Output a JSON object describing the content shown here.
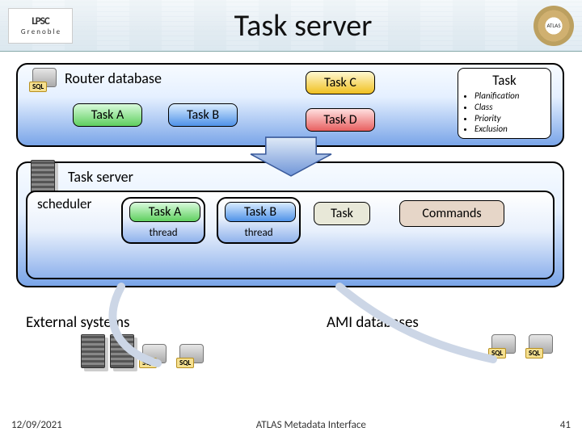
{
  "title": "Task server",
  "logos": {
    "lpsc_top": "LPSC",
    "lpsc_sub": "G r e n o b l e",
    "atlas": "ATLAS"
  },
  "router": {
    "label": "Router database",
    "tasks": {
      "a": "Task A",
      "b": "Task B",
      "c": "Task C",
      "d": "Task D"
    }
  },
  "task_info": {
    "header": "Task",
    "items": [
      "Planification",
      "Class",
      "Priority",
      "Exclusion"
    ]
  },
  "server": {
    "label": "Task server",
    "scheduler_label": "scheduler",
    "task_a": "Task A",
    "task_b": "Task B",
    "task_generic": "Task",
    "thread": "thread",
    "commands": "Commands"
  },
  "bottom": {
    "external": "External systems",
    "ami": "AMI databases"
  },
  "footer": {
    "date": "12/09/2021",
    "center": "ATLAS Metadata Interface",
    "page": "41"
  }
}
